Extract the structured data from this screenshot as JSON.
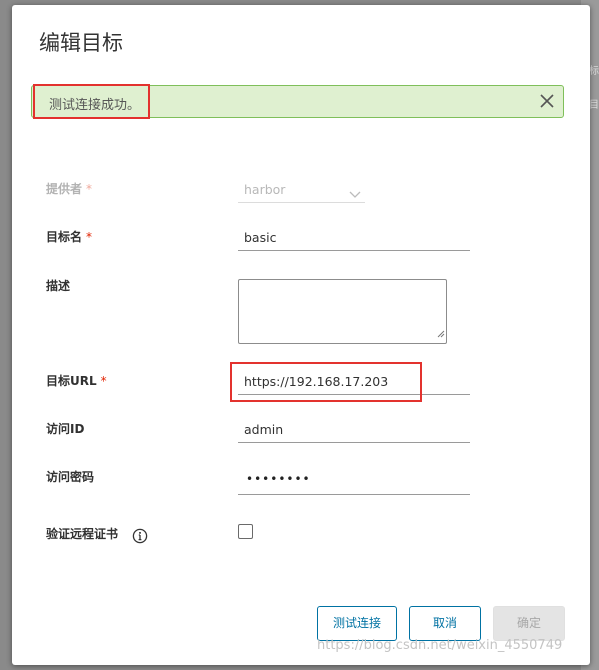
{
  "backdrop": {
    "edge_text_top": "标",
    "edge_text_mid": "目"
  },
  "modal": {
    "title": "编辑目标"
  },
  "alert": {
    "message": "测试连接成功。",
    "close_icon": "close-icon"
  },
  "form": {
    "provider": {
      "label": "提供者",
      "required_mark": "*",
      "value": "harbor"
    },
    "target_name": {
      "label": "目标名",
      "required_mark": "*",
      "value": "basic"
    },
    "description": {
      "label": "描述",
      "value": ""
    },
    "target_url": {
      "label": "目标URL",
      "required_mark": "*",
      "value": "https://192.168.17.203"
    },
    "access_id": {
      "label": "访问ID",
      "value": "admin"
    },
    "access_secret": {
      "label": "访问密码",
      "value": "••••••••"
    },
    "verify_cert": {
      "label": "验证远程证书",
      "checked": false,
      "info_icon": "info-icon"
    }
  },
  "buttons": {
    "test": "测试连接",
    "cancel": "取消",
    "ok": "确定"
  },
  "watermark": "https://blog.csdn.net/weixin_4550749",
  "colors": {
    "accent": "#0072a3",
    "success_bg": "#dff0d0",
    "success_border": "#7fbf5a",
    "required": "#e12200",
    "highlight": "#e3322e"
  }
}
